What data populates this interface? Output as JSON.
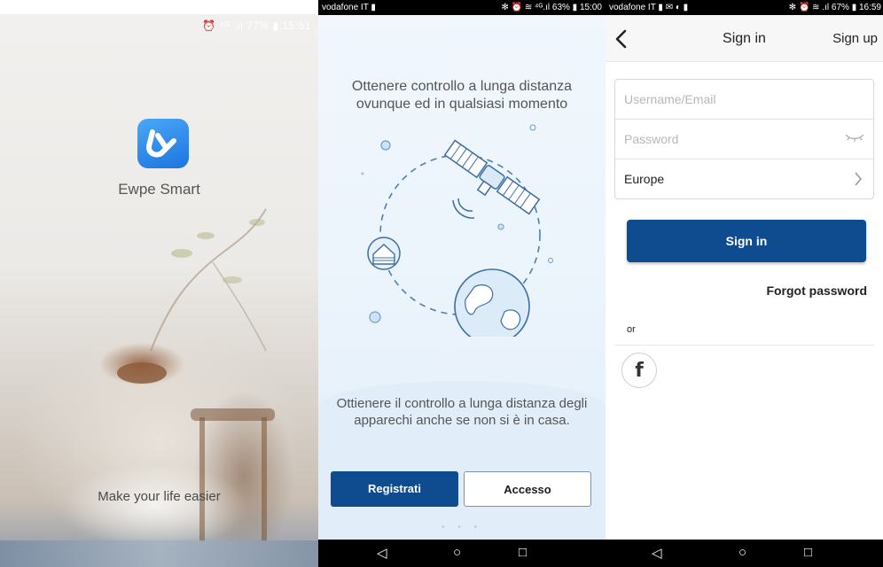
{
  "splash": {
    "status_text": "⏰ ⁴ᴳ .ıl 77% ▮ 15:51",
    "app_name": "Ewpe Smart",
    "tagline": "Make your life easier",
    "logo_color": "#2a88ec"
  },
  "onboarding": {
    "status_left": "vodafone IT ▮",
    "status_right": "✻ ⏰ ≋ ⁴ᴳ.ıl 63% ▮ 15:00",
    "headline": "Ottenere controllo a lunga distanza ovunque ed in qualsiasi momento",
    "caption": "Ottienere il controllo a lunga distanza degli apparechi anche se non si è in casa.",
    "register_label": "Registrati",
    "login_label": "Accesso",
    "page_dots": "• • •",
    "accent_color": "#0e4b8f"
  },
  "signin": {
    "status_left": "vodafone IT ▮ ✉ ◐ ▮",
    "status_right": "✻ ⏰ ≋ .ıl 67% ▮ 16:59",
    "title": "Sign in",
    "back_icon": "chevron-left-icon",
    "signup_label": "Sign up",
    "username_placeholder": "Username/Email",
    "password_placeholder": "Password",
    "region_value": "Europe",
    "signin_button": "Sign in",
    "forgot_label": "Forgot password",
    "or_label": "or",
    "facebook_glyph": "f"
  },
  "nav": {
    "back": "◁",
    "home": "○",
    "recents": "□"
  }
}
